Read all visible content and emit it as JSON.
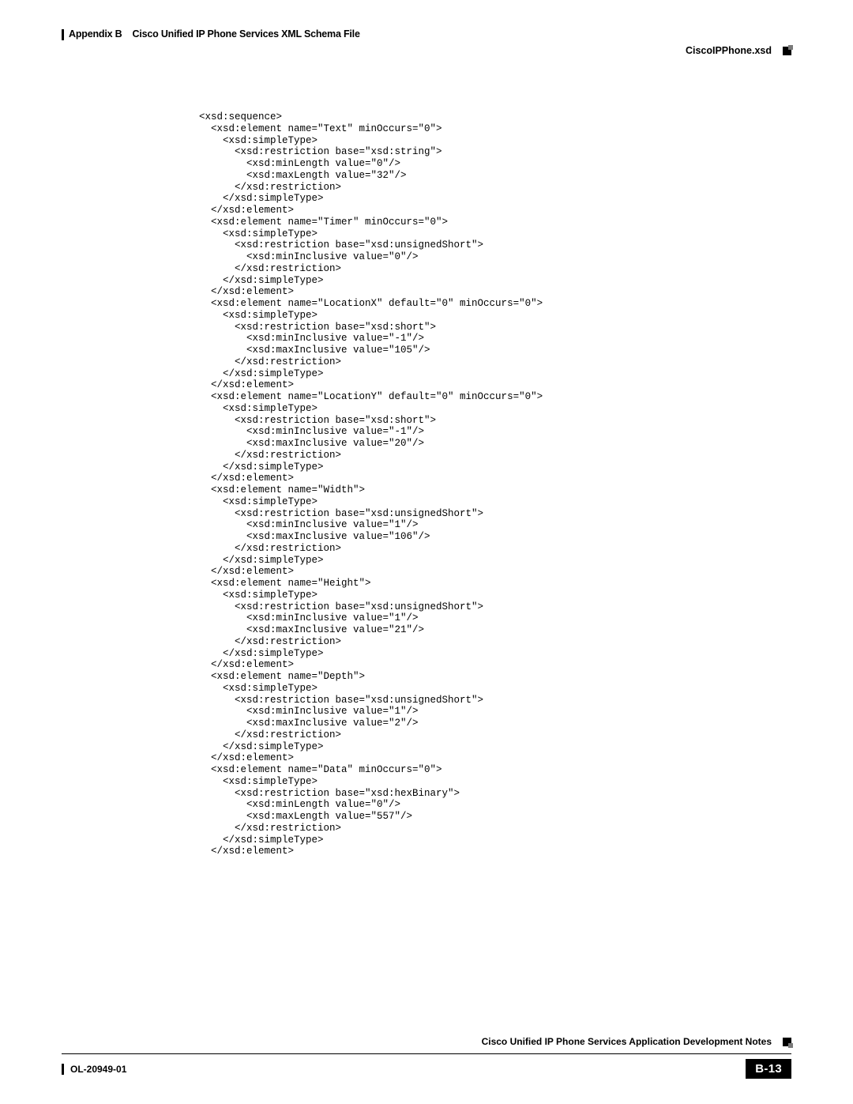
{
  "header": {
    "appendix_label": "Appendix B",
    "appendix_title": "Cisco Unified IP Phone Services XML Schema File",
    "section_title": "CiscoIPPhone.xsd"
  },
  "code_lines": [
    "<xsd:sequence>",
    "  <xsd:element name=\"Text\" minOccurs=\"0\">",
    "    <xsd:simpleType>",
    "      <xsd:restriction base=\"xsd:string\">",
    "        <xsd:minLength value=\"0\"/>",
    "        <xsd:maxLength value=\"32\"/>",
    "      </xsd:restriction>",
    "    </xsd:simpleType>",
    "  </xsd:element>",
    "  <xsd:element name=\"Timer\" minOccurs=\"0\">",
    "    <xsd:simpleType>",
    "      <xsd:restriction base=\"xsd:unsignedShort\">",
    "        <xsd:minInclusive value=\"0\"/>",
    "      </xsd:restriction>",
    "    </xsd:simpleType>",
    "  </xsd:element>",
    "  <xsd:element name=\"LocationX\" default=\"0\" minOccurs=\"0\">",
    "    <xsd:simpleType>",
    "      <xsd:restriction base=\"xsd:short\">",
    "        <xsd:minInclusive value=\"-1\"/>",
    "        <xsd:maxInclusive value=\"105\"/>",
    "      </xsd:restriction>",
    "    </xsd:simpleType>",
    "  </xsd:element>",
    "  <xsd:element name=\"LocationY\" default=\"0\" minOccurs=\"0\">",
    "    <xsd:simpleType>",
    "      <xsd:restriction base=\"xsd:short\">",
    "        <xsd:minInclusive value=\"-1\"/>",
    "        <xsd:maxInclusive value=\"20\"/>",
    "      </xsd:restriction>",
    "    </xsd:simpleType>",
    "  </xsd:element>",
    "  <xsd:element name=\"Width\">",
    "    <xsd:simpleType>",
    "      <xsd:restriction base=\"xsd:unsignedShort\">",
    "        <xsd:minInclusive value=\"1\"/>",
    "        <xsd:maxInclusive value=\"106\"/>",
    "      </xsd:restriction>",
    "    </xsd:simpleType>",
    "  </xsd:element>",
    "  <xsd:element name=\"Height\">",
    "    <xsd:simpleType>",
    "      <xsd:restriction base=\"xsd:unsignedShort\">",
    "        <xsd:minInclusive value=\"1\"/>",
    "        <xsd:maxInclusive value=\"21\"/>",
    "      </xsd:restriction>",
    "    </xsd:simpleType>",
    "  </xsd:element>",
    "  <xsd:element name=\"Depth\">",
    "    <xsd:simpleType>",
    "      <xsd:restriction base=\"xsd:unsignedShort\">",
    "        <xsd:minInclusive value=\"1\"/>",
    "        <xsd:maxInclusive value=\"2\"/>",
    "      </xsd:restriction>",
    "    </xsd:simpleType>",
    "  </xsd:element>",
    "  <xsd:element name=\"Data\" minOccurs=\"0\">",
    "    <xsd:simpleType>",
    "      <xsd:restriction base=\"xsd:hexBinary\">",
    "        <xsd:minLength value=\"0\"/>",
    "        <xsd:maxLength value=\"557\"/>",
    "      </xsd:restriction>",
    "    </xsd:simpleType>",
    "  </xsd:element>"
  ],
  "footer": {
    "book_title": "Cisco Unified IP Phone Services Application Development Notes",
    "doc_id": "OL-20949-01",
    "page_number": "B-13"
  }
}
